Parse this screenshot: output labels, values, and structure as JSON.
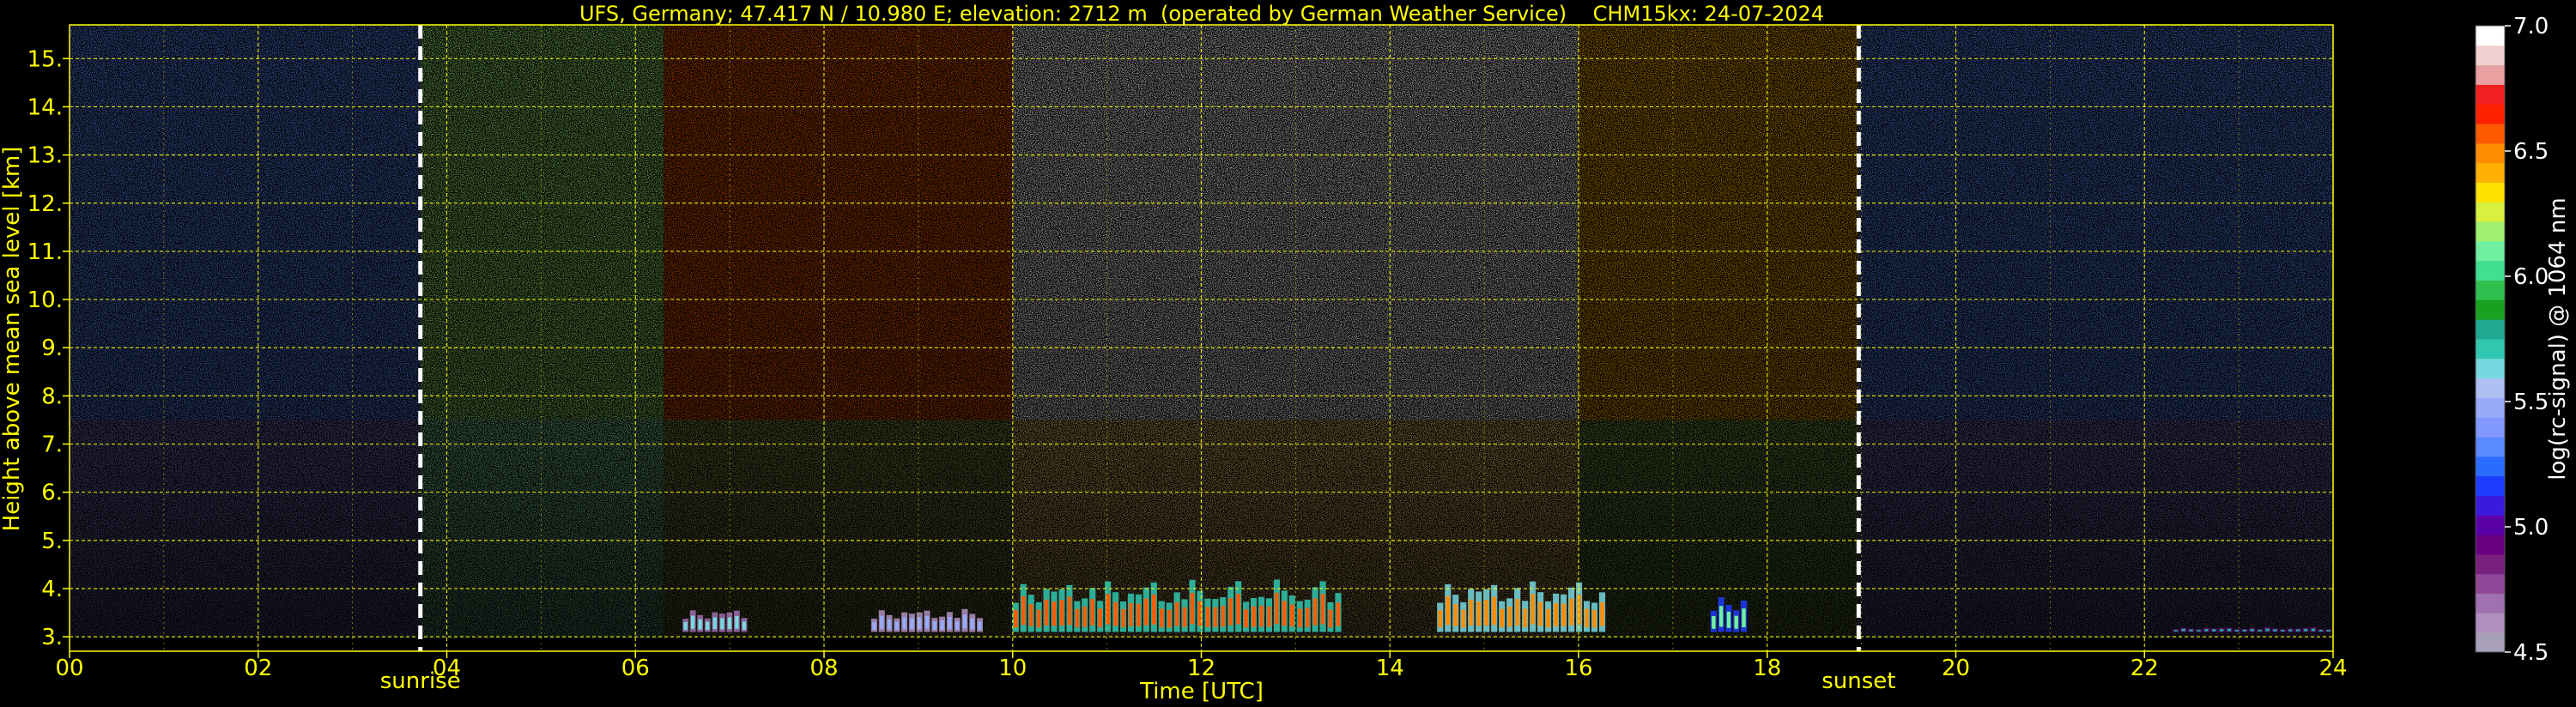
{
  "chart_data": {
    "type": "heatmap",
    "title": "UFS, Germany; 47.417 N / 10.980 E; elevation: 2712 m  (operated by German Weather Service)    CHM15kx: 24-07-2024",
    "xlabel": "Time [UTC]",
    "ylabel": "Height above mean sea level [km]",
    "xlim": [
      0,
      24
    ],
    "ylim": [
      2.7,
      15.7
    ],
    "x_ticks": [
      0,
      2,
      4,
      6,
      8,
      10,
      12,
      14,
      16,
      18,
      20,
      22,
      24
    ],
    "x_tick_labels": [
      "00",
      "02",
      "04",
      "06",
      "08",
      "10",
      "12",
      "14",
      "16",
      "18",
      "20",
      "22",
      "24"
    ],
    "y_ticks": [
      3,
      4,
      5,
      6,
      7,
      8,
      9,
      10,
      11,
      12,
      13,
      14,
      15
    ],
    "y_tick_labels": [
      "3.",
      "4.",
      "5.",
      "6.",
      "7.",
      "8.",
      "9.",
      "10.",
      "11.",
      "12.",
      "13.",
      "14.",
      "15."
    ],
    "grid": true,
    "markers": [
      {
        "label": "sunrise",
        "time": 3.72
      },
      {
        "label": "sunset",
        "time": 18.97
      }
    ],
    "colorbar": {
      "label": "log(rc-signal) @ 1064 nm",
      "range": [
        4.5,
        7.0
      ],
      "ticks": [
        4.5,
        5.0,
        5.5,
        6.0,
        6.5,
        7.0
      ],
      "tick_labels": [
        "4.5",
        "5.0",
        "5.5",
        "6.0",
        "6.5",
        "7.0"
      ],
      "colors": [
        "#a8a0b8",
        "#b090c0",
        "#a070b0",
        "#904898",
        "#78207e",
        "#6a0080",
        "#5a00a8",
        "#3c1adc",
        "#1e3cff",
        "#2a6cff",
        "#5a8aff",
        "#8098ff",
        "#98aaf8",
        "#b0c0f4",
        "#78d8e0",
        "#30c8b0",
        "#20a890",
        "#18a020",
        "#30c050",
        "#40e090",
        "#70f0a0",
        "#a0f070",
        "#d8f040",
        "#ffe000",
        "#ffb000",
        "#ff8c00",
        "#ff5a00",
        "#ff2000",
        "#f02020",
        "#e8a0a0",
        "#f0d0d0",
        "#ffffff"
      ]
    },
    "background_bands": [
      {
        "start": 0.0,
        "end": 3.72,
        "dominant_level": 5.3
      },
      {
        "start": 3.72,
        "end": 6.3,
        "dominant_level": 6.2
      },
      {
        "start": 6.3,
        "end": 10.0,
        "dominant_level": 6.6
      },
      {
        "start": 10.0,
        "end": 16.0,
        "dominant_level": 7.0
      },
      {
        "start": 16.0,
        "end": 18.97,
        "dominant_level": 6.4
      },
      {
        "start": 18.97,
        "end": 24.0,
        "dominant_level": 5.3
      }
    ],
    "boundary_layer_features": [
      {
        "time_start": 6.5,
        "time_end": 7.2,
        "height_top_km": 3.6,
        "level": 5.6
      },
      {
        "time_start": 8.5,
        "time_end": 9.7,
        "height_top_km": 3.6,
        "level": 5.5
      },
      {
        "time_start": 10.0,
        "time_end": 13.5,
        "height_top_km": 4.2,
        "level": 6.6
      },
      {
        "time_start": 14.5,
        "time_end": 16.3,
        "height_top_km": 4.2,
        "level": 6.5
      },
      {
        "time_start": 17.4,
        "time_end": 17.8,
        "height_top_km": 3.9,
        "level": 6.1
      },
      {
        "time_start": 22.3,
        "time_end": 24.0,
        "height_top_km": 3.2,
        "level": 5.8
      }
    ]
  }
}
